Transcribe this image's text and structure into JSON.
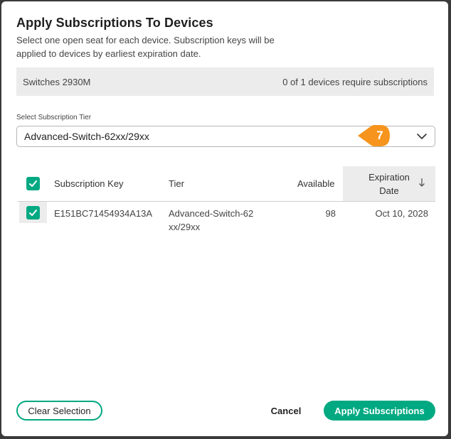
{
  "dialog": {
    "title": "Apply Subscriptions To Devices",
    "description": "Select one open seat for each device. Subscription keys will be applied to devices by earliest expiration date."
  },
  "device_bar": {
    "device": "Switches 2930M",
    "status": "0 of 1 devices require subscriptions"
  },
  "tier_select": {
    "label": "Select Subscription Tier",
    "value": "Advanced-Switch-62xx/29xx",
    "icon": "chevron-down-icon"
  },
  "callout": {
    "number": "7",
    "color": "#f7941d"
  },
  "table": {
    "header_checked": true,
    "columns": {
      "key": "Subscription Key",
      "tier": "Tier",
      "available": "Available",
      "expiration": "Expiration Date",
      "sort_icon": "arrow-down-icon"
    },
    "rows": [
      {
        "checked": true,
        "key": "E151BC71454934A13A",
        "tier": "Advanced-Switch-62xx/29xx",
        "available": "98",
        "expiration": "Oct 10, 2028"
      }
    ]
  },
  "footer": {
    "clear_label": "Clear Selection",
    "cancel_label": "Cancel",
    "apply_label": "Apply Subscriptions"
  },
  "colors": {
    "accent": "#01a982",
    "callout": "#f7941d",
    "header_bg": "#ececec"
  }
}
